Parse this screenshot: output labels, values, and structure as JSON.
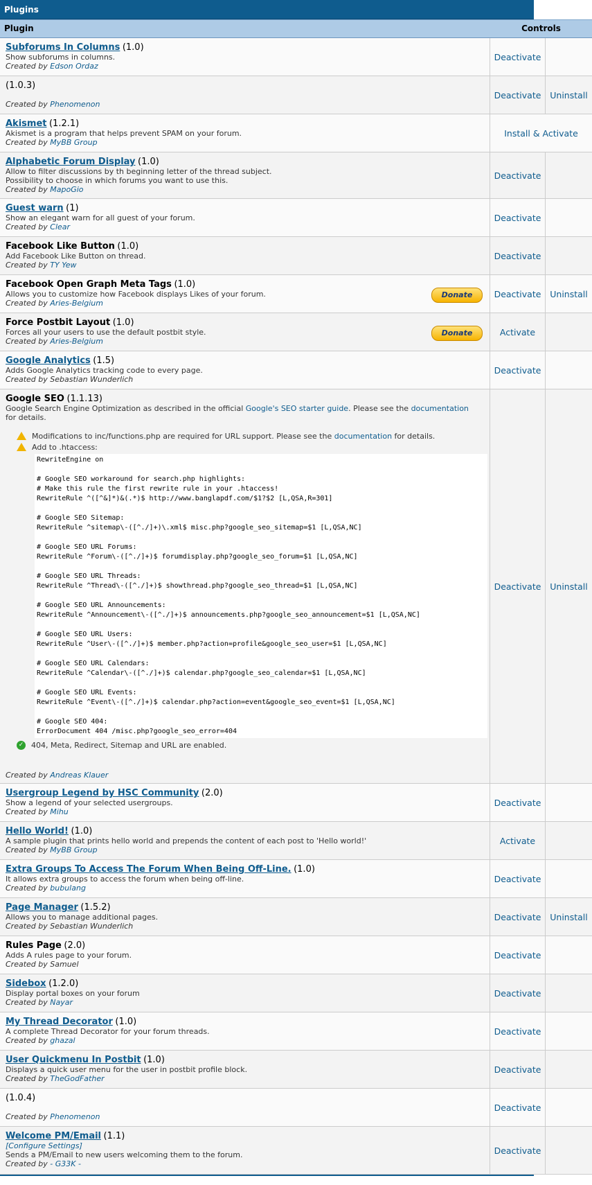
{
  "table": {
    "title": "Plugins",
    "col_plugin": "Plugin",
    "col_controls": "Controls"
  },
  "labels": {
    "created_by": "Created by",
    "donate": "Donate"
  },
  "plugins": [
    {
      "name": "Subforums In Columns",
      "version": "(1.0)",
      "desc": "Show subforums in columns.",
      "author": "Edson Ordaz",
      "action1": "Deactivate",
      "action2": ""
    },
    {
      "name": "",
      "version": "(1.0.3)",
      "desc": "",
      "author": "Phenomenon",
      "action1": "Deactivate",
      "action2": "Uninstall"
    },
    {
      "name": "Akismet",
      "version": "(1.2.1)",
      "desc": "Akismet is a program that helps prevent SPAM on your forum.",
      "author": "MyBB Group",
      "action1": "Install & Activate",
      "action2": ""
    },
    {
      "name": "Alphabetic Forum Display",
      "version": "(1.0)",
      "desc": "Allow to filter discussions by th beginning letter of the thread subject.",
      "desc2": "Possibility to choose in which forums you want to use this.",
      "author": "MapoGio",
      "action1": "Deactivate",
      "action2": ""
    },
    {
      "name": "Guest warn",
      "version": "(1)",
      "desc": "Show an elegant warn for all guest of your forum.",
      "author": "Clear",
      "action1": "Deactivate",
      "action2": ""
    },
    {
      "name": "Facebook Like Button",
      "version": "(1.0)",
      "desc": "Add Facebook Like Button on thread.",
      "author": "TY Yew",
      "action1": "Deactivate",
      "action2": ""
    },
    {
      "name": "Facebook Open Graph Meta Tags",
      "version": "(1.0)",
      "desc": "Allows you to customize how Facebook displays Likes of your forum.",
      "author": "Aries-Belgium",
      "action1": "Deactivate",
      "action2": "Uninstall"
    },
    {
      "name": "Force Postbit Layout",
      "version": "(1.0)",
      "desc": "Forces all your users to use the default postbit style.",
      "author": "Aries-Belgium",
      "action1": "Activate",
      "action2": ""
    },
    {
      "name": "Google Analytics",
      "version": "(1.5)",
      "desc": "Adds Google Analytics tracking code to every page.",
      "author": "Sebastian Wunderlich",
      "action1": "Deactivate",
      "action2": ""
    }
  ],
  "seo": {
    "name": "Google SEO",
    "version": "(1.1.13)",
    "desc_a": "Google Search Engine Optimization as described in the official ",
    "desc_link1": "Google's SEO starter guide",
    "desc_b": ". Please see the ",
    "desc_link2": "documentation",
    "desc_c": "for details.",
    "warn1_a": "Modifications to inc/functions.php are required for URL support. Please see the ",
    "warn1_link": "documentation",
    "warn1_b": " for details.",
    "warn2": "Add to .htaccess:",
    "code": "RewriteEngine on\n\n# Google SEO workaround for search.php highlights:\n# Make this rule the first rewrite rule in your .htaccess!\nRewriteRule ^([^&]*)&(.*)$ http://www.banglapdf.com/$1?$2 [L,QSA,R=301]\n\n# Google SEO Sitemap:\nRewriteRule ^sitemap\\-([^./]+)\\.xml$ misc.php?google_seo_sitemap=$1 [L,QSA,NC]\n\n# Google SEO URL Forums:\nRewriteRule ^Forum\\-([^./]+)$ forumdisplay.php?google_seo_forum=$1 [L,QSA,NC]\n\n# Google SEO URL Threads:\nRewriteRule ^Thread\\-([^./]+)$ showthread.php?google_seo_thread=$1 [L,QSA,NC]\n\n# Google SEO URL Announcements:\nRewriteRule ^Announcement\\-([^./]+)$ announcements.php?google_seo_announcement=$1 [L,QSA,NC]\n\n# Google SEO URL Users:\nRewriteRule ^User\\-([^./]+)$ member.php?action=profile&google_seo_user=$1 [L,QSA,NC]\n\n# Google SEO URL Calendars:\nRewriteRule ^Calendar\\-([^./]+)$ calendar.php?google_seo_calendar=$1 [L,QSA,NC]\n\n# Google SEO URL Events:\nRewriteRule ^Event\\-([^./]+)$ calendar.php?action=event&google_seo_event=$1 [L,QSA,NC]\n\n# Google SEO 404:\nErrorDocument 404 /misc.php?google_seo_error=404",
    "ok": "404, Meta, Redirect, Sitemap and URL are enabled.",
    "author": "Andreas Klauer",
    "action1": "Deactivate",
    "action2": "Uninstall"
  },
  "plugins2": [
    {
      "name": "Usergroup Legend by HSC Community",
      "version": "(2.0)",
      "desc": "Show a legend of your selected usergroups.",
      "author": "Mihu",
      "action1": "Deactivate",
      "action2": ""
    },
    {
      "name": "Hello World!",
      "version": "(1.0)",
      "desc": "A sample plugin that prints hello world and prepends the content of each post to 'Hello world!'",
      "author": "MyBB Group",
      "action1": "Activate",
      "action2": ""
    },
    {
      "name": "Extra Groups To Access The Forum When Being Off-Line.",
      "version": "(1.0)",
      "desc": "It allows extra groups to access the forum when being off-line.",
      "author": "bubulang",
      "action1": "Deactivate",
      "action2": ""
    },
    {
      "name": "Page Manager",
      "version": "(1.5.2)",
      "desc": "Allows you to manage additional pages.",
      "author": "Sebastian Wunderlich",
      "action1": "Deactivate",
      "action2": "Uninstall"
    },
    {
      "name": "Rules Page",
      "version": "(2.0)",
      "desc": "Adds A rules page to your forum.",
      "author": "Samuel",
      "action1": "Deactivate",
      "action2": ""
    },
    {
      "name": "Sidebox",
      "version": "(1.2.0)",
      "desc": "Display portal boxes on your forum",
      "author": "Nayar",
      "action1": "Deactivate",
      "action2": ""
    },
    {
      "name": "My Thread Decorator",
      "version": "(1.0)",
      "desc": "A complete Thread Decorator for your forum threads.",
      "author": "ghazal",
      "action1": "Deactivate",
      "action2": ""
    },
    {
      "name": "User Quickmenu In Postbit",
      "version": "(1.0)",
      "desc": "Displays a quick user menu for the user in postbit profile block.",
      "author": "TheGodFather",
      "action1": "Deactivate",
      "action2": ""
    },
    {
      "name": "",
      "version": "(1.0.4)",
      "desc": "",
      "author": "Phenomenon",
      "action1": "Deactivate",
      "action2": ""
    },
    {
      "name": "Welcome PM/Email",
      "version": "(1.1)",
      "configure": "[Configure Settings]",
      "desc": "Sends a PM/Email to new users welcoming them to the forum.",
      "author": "- G33K -",
      "action1": "Deactivate",
      "action2": ""
    }
  ]
}
